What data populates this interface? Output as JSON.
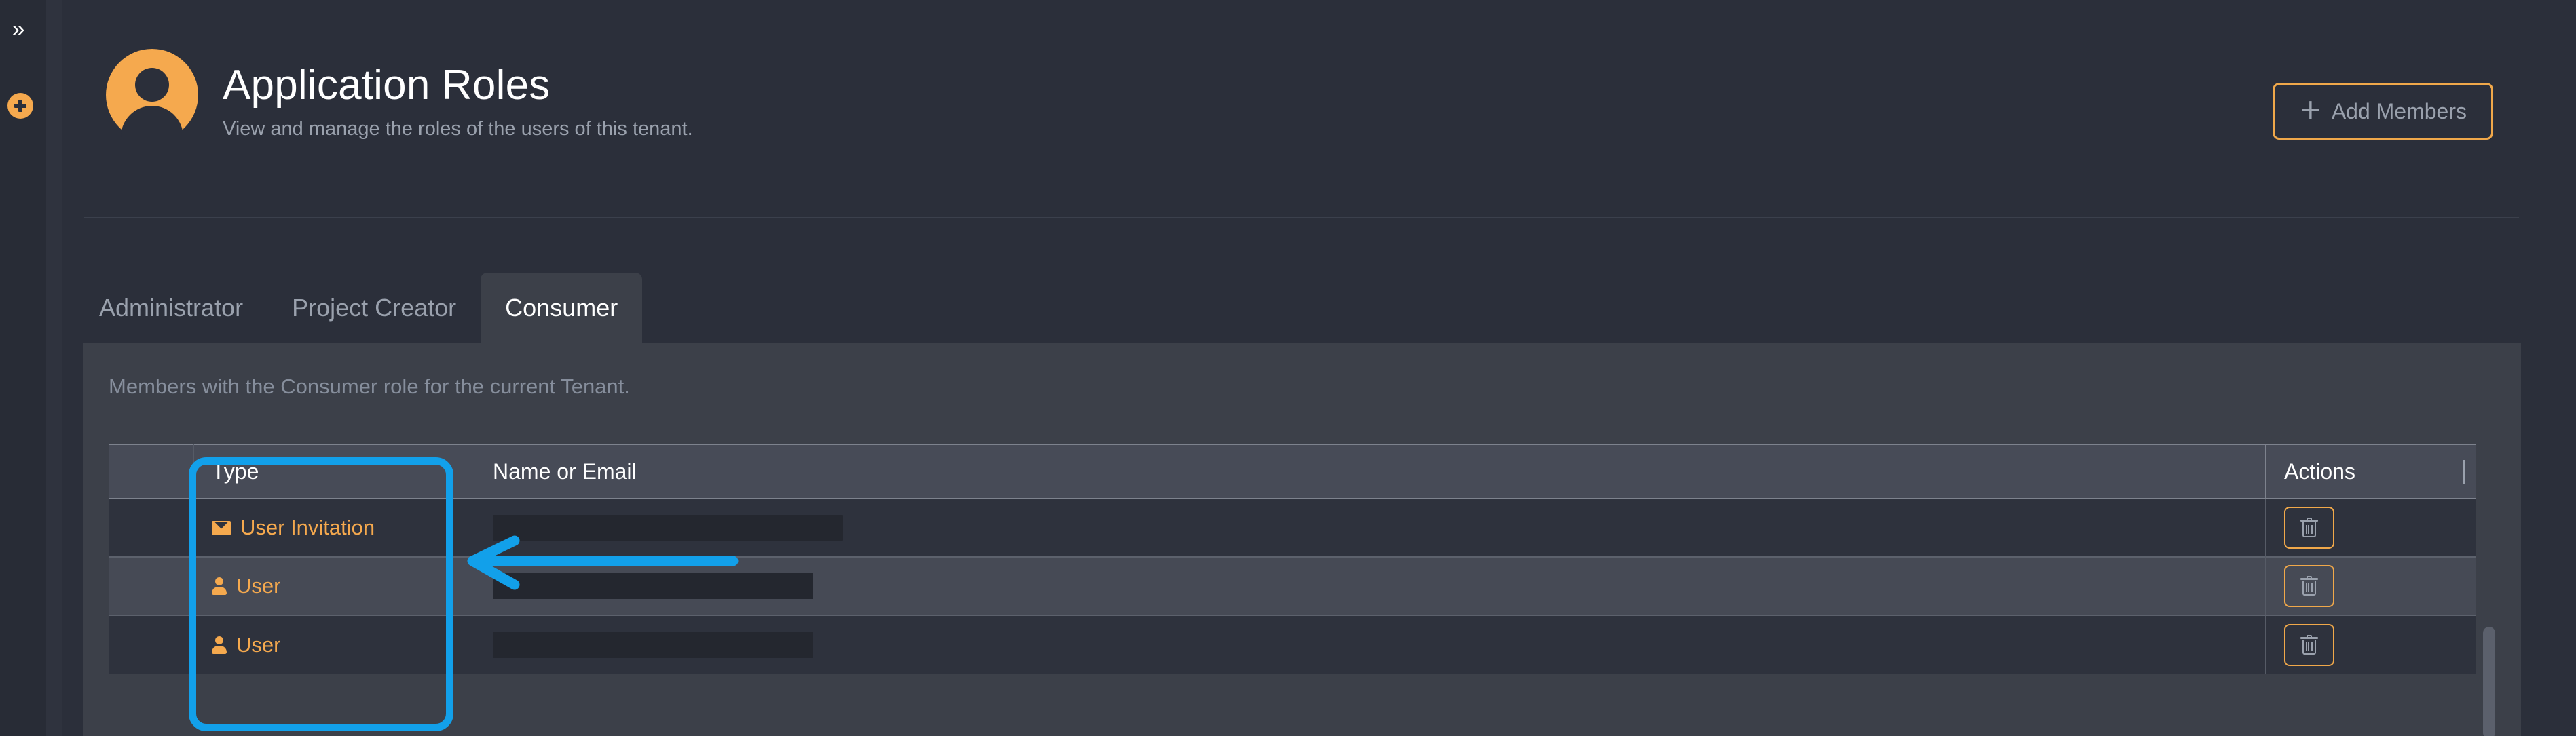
{
  "rail": {
    "expand_icon": "chevron-double-right-icon",
    "expand_glyph": "»",
    "add_icon": "plus-circle-icon"
  },
  "header": {
    "avatar_icon": "user-avatar-icon",
    "title": "Application Roles",
    "subtitle": "View and manage the roles of the users of this tenant.",
    "add_members": {
      "label": "Add Members",
      "plus_glyph": "＋",
      "icon": "plus-icon",
      "border_color": "#f0a84a",
      "text_color": "#9aa1ad"
    }
  },
  "tabs": [
    {
      "label": "Administrator",
      "active": false
    },
    {
      "label": "Project Creator",
      "active": false
    },
    {
      "label": "Consumer",
      "active": true
    }
  ],
  "panel": {
    "description": "Members with the Consumer role for the current Tenant."
  },
  "table": {
    "columns": [
      {
        "key": "check",
        "label": ""
      },
      {
        "key": "type",
        "label": "Type"
      },
      {
        "key": "name",
        "label": "Name or Email"
      },
      {
        "key": "actions",
        "label": "Actions"
      }
    ],
    "rows": [
      {
        "type_label": "User Invitation",
        "type_icon": "envelope-icon",
        "name_or_email": "",
        "name_redacted": true,
        "redacted_width": 516,
        "action_icon": "trash-icon"
      },
      {
        "type_label": "User",
        "type_icon": "person-icon",
        "name_or_email": "",
        "name_redacted": true,
        "redacted_width": 472,
        "action_icon": "trash-icon"
      },
      {
        "type_label": "User",
        "type_icon": "person-icon",
        "name_or_email": "",
        "name_redacted": true,
        "redacted_width": 472,
        "action_icon": "trash-icon"
      }
    ]
  },
  "annotations": {
    "highlight_color": "#12a0ea",
    "highlight_target": "type-column",
    "arrow_direction": "left",
    "arrow_target": "name-or-email-cell-row-1"
  },
  "theme": {
    "page_bg": "#2b2f3a",
    "rail_bg": "#282c36",
    "panel_bg": "#3c4049",
    "row_odd_bg": "#2e323d",
    "row_even_bg": "#464a55",
    "header_row_bg": "#474b57",
    "accent_orange": "#f5a94e",
    "muted_text": "#9aa1ad"
  }
}
